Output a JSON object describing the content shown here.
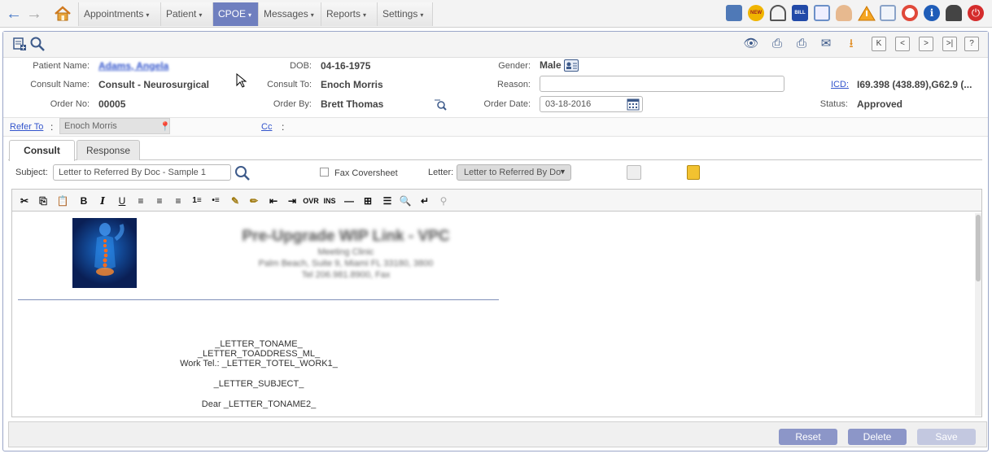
{
  "nav": {
    "menus": [
      {
        "label": "Appointments"
      },
      {
        "label": "Patient"
      },
      {
        "label": "CPOE"
      },
      {
        "label": "Messages"
      },
      {
        "label": "Reports"
      },
      {
        "label": "Settings"
      }
    ],
    "active": "CPOE",
    "caret": "▾"
  },
  "patient": {
    "name_label": "Patient Name:",
    "name_value": "Adams, Angela",
    "dob_label": "DOB:",
    "dob_value": "04-16-1975",
    "gender_label": "Gender:",
    "gender_value": "Male"
  },
  "consult": {
    "name_label": "Consult Name:",
    "name_value": "Consult - Neurosurgical",
    "to_label": "Consult To:",
    "to_value": "Enoch Morris",
    "reason_label": "Reason:",
    "reason_value": "",
    "icd_label": "ICD:",
    "icd_value": "I69.398 (438.89),G62.9 (...",
    "order_no_label": "Order No:",
    "order_no_value": "00005",
    "order_by_label": "Order By:",
    "order_by_value": "Brett Thomas",
    "order_date_label": "Order Date:",
    "order_date_value": "03-18-2016",
    "status_label": "Status:",
    "status_value": "Approved",
    "refer_to_label": "Refer To",
    "refer_to_value": "Enoch Morris",
    "cc_label": "Cc",
    "colon": ":"
  },
  "tabs": [
    {
      "label": "Consult"
    },
    {
      "label": "Response"
    }
  ],
  "subject": {
    "label": "Subject:",
    "value": "Letter to Referred By Doc - Sample 1",
    "fax_label": "Fax Coversheet",
    "letter_label": "Letter:",
    "letter_value": "Letter to Referred By Do"
  },
  "toolbar": {
    "bold": "B",
    "italic": "I",
    "underline": "U",
    "ovr": "OVR",
    "ins": "INS"
  },
  "letter": {
    "header_title": "Pre-Upgrade WIP Link - VPC",
    "header_line1": "Meeting Clinic",
    "header_line2": "Palm Beach, Suite 9, Miami FL 33180, 3800",
    "header_line3": "Tel 206.981.8900, Fax",
    "lines": [
      "_LETTER_TONAME_",
      "_LETTER_TOADDRESS_ML_",
      "Work Tel.: _LETTER_TOTEL_WORK1_",
      "_LETTER_SUBJECT_",
      "Dear _LETTER_TONAME2_"
    ]
  },
  "buttons": {
    "reset": "Reset",
    "delete": "Delete",
    "save": "Save"
  },
  "colors": {
    "accent": "#6f7fbf",
    "link": "#3355cc",
    "button": "#8c96c8",
    "button_disabled": "#c3c8e0"
  }
}
